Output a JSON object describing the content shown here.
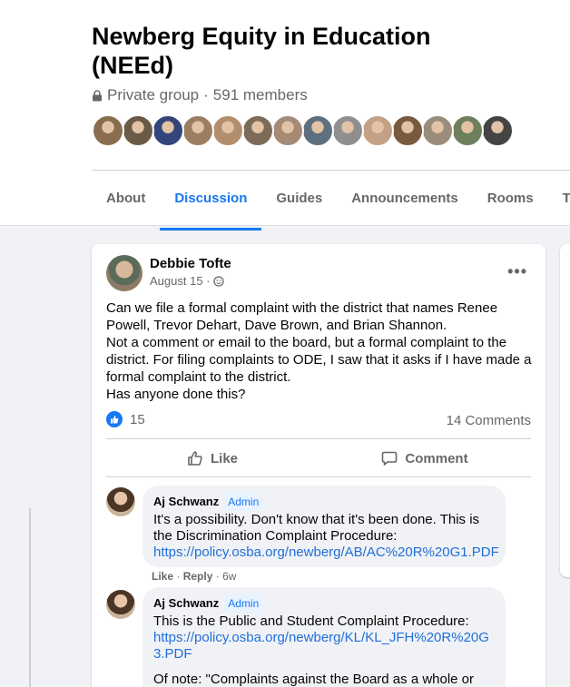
{
  "group": {
    "title": "Newberg Equity in Education (NEEd)",
    "privacy": "Private group",
    "members": "591 members"
  },
  "member_avatars": [
    "#8a6d4e",
    "#6b5a45",
    "#33457a",
    "#9c7f62",
    "#b38e6d",
    "#7d6b5a",
    "#a58a75",
    "#5e6f7e",
    "#8f8f8f",
    "#c4a184",
    "#7a5a3f",
    "#9a8d7c",
    "#6e7f5b",
    "#444444"
  ],
  "tabs": [
    {
      "label": "About",
      "active": false
    },
    {
      "label": "Discussion",
      "active": true
    },
    {
      "label": "Guides",
      "active": false
    },
    {
      "label": "Announcements",
      "active": false
    },
    {
      "label": "Rooms",
      "active": false
    },
    {
      "label": "Topic",
      "active": false
    }
  ],
  "post": {
    "author": "Debbie Tofte",
    "date": "August 15 ·",
    "body": [
      "Can we file a formal complaint with the district that names Renee Powell, Trevor Dehart, Dave Brown, and Brian Shannon.",
      "Not a comment or email to the board, but a formal complaint to the district.  For filing complaints to ODE, I saw that it asks if I have made a formal complaint to the district.",
      "Has anyone done this?"
    ],
    "reaction_count": "15",
    "comment_count": "14 Comments",
    "like_label": "Like",
    "comment_label": "Comment"
  },
  "comments": [
    {
      "author": "Aj Schwanz",
      "badge": "Admin",
      "text": "It's a possibility. Don't know that it's been done. This is the Discrimination Complaint Procedure:",
      "link": "https://policy.osba.org/newberg/AB/AC%20R%20G1.PDF",
      "like": "Like",
      "reply": "Reply",
      "time": "6w"
    },
    {
      "author": "Aj Schwanz",
      "badge": "Admin",
      "text": "This is the Public and Student Complaint Procedure:",
      "link": "https://policy.osba.org/newberg/KL/KL_JFH%20R%20G3.PDF",
      "note": "Of note: \"Complaints against the Board as a whole or"
    }
  ],
  "colors": {
    "accent": "#1877f2",
    "link": "#216fdb",
    "secondary_text": "#65676b",
    "background": "#f0f2f5"
  },
  "icons": [
    "lock-icon",
    "globe-icon",
    "more-icon",
    "like-reaction-icon",
    "thumbs-up-icon",
    "comment-icon"
  ]
}
